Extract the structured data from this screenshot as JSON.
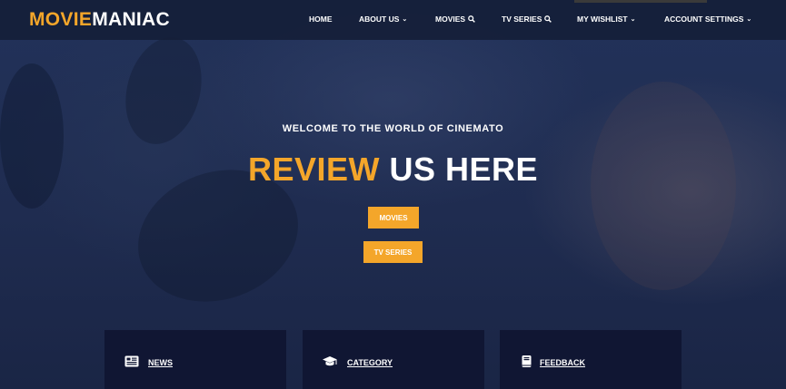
{
  "brand": {
    "accent_part": "MOVIE",
    "rest_part": "MANIAC",
    "accent_color": "#f4a62a"
  },
  "nav": {
    "home": "HOME",
    "about": "ABOUT US",
    "movies": "MOVIES",
    "tv_series": "TV SERIES",
    "wishlist": "MY WISHLIST",
    "account": "ACCOUNT SETTINGS",
    "chevron_icon": "chevron-down-icon",
    "search_icon": "search-icon"
  },
  "hero": {
    "welcome": "WELCOME TO THE WORLD OF CINEMATO",
    "headline_accent": "REVIEW",
    "headline_rest": "US HERE",
    "btn_movies": "MOVIES",
    "btn_tv": "TV SERIES"
  },
  "cards": {
    "news": {
      "label": "NEWS",
      "icon": "newspaper-icon"
    },
    "category": {
      "label": "CATEGORY",
      "icon": "graduation-cap-icon"
    },
    "feedback": {
      "label": "FEEDBACK",
      "icon": "book-icon"
    }
  },
  "colors": {
    "navbar_bg": "#151e38",
    "card_bg": "#101633",
    "hero_bg": "#1f2c50"
  }
}
